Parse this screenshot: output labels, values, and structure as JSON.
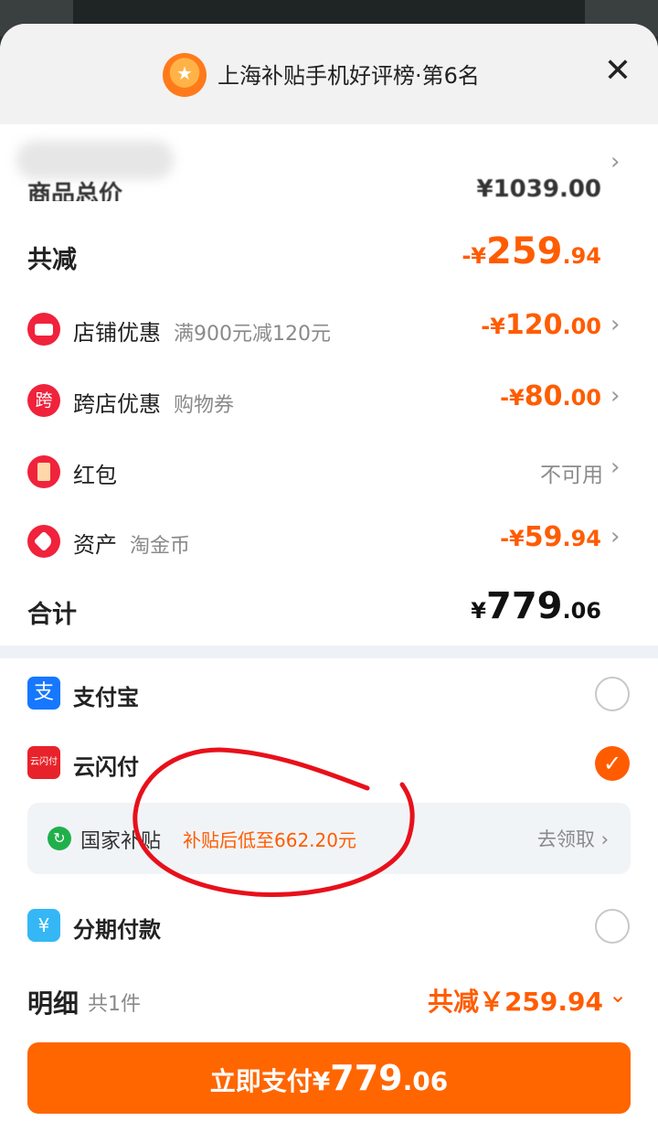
{
  "header": {
    "title": "上海补贴手机好评榜·第6名",
    "close": "✕"
  },
  "summary": {
    "obscured_label": "商品总价",
    "obscured_amount": "¥1039.00",
    "total_discount": {
      "label": "共减",
      "prefix": "-¥",
      "int": "259",
      "dec": ".94"
    },
    "rows": [
      {
        "label": "店铺优惠",
        "sub": "满900元减120元",
        "prefix": "-¥",
        "int": "120",
        "dec": ".00",
        "icon": "store-icon"
      },
      {
        "label": "跨店优惠",
        "sub": "购物券",
        "prefix": "-¥",
        "int": "80",
        "dec": ".00",
        "icon_text": "跨"
      },
      {
        "label": "红包",
        "sub": "",
        "status": "不可用",
        "icon": "red-envelope-icon"
      },
      {
        "label": "资产",
        "sub": "淘金币",
        "prefix": "-¥",
        "int": "59",
        "dec": ".94",
        "icon": "tag-icon"
      }
    ],
    "total": {
      "label": "合计",
      "prefix": "¥",
      "int": "779",
      "dec": ".06"
    }
  },
  "payment": {
    "methods": [
      {
        "label": "支付宝",
        "icon": "alipay-icon",
        "icon_text": "支",
        "selected": false
      },
      {
        "label": "云闪付",
        "icon": "unionpay-quickpass-icon",
        "icon_text": "云闪付",
        "selected": true
      },
      {
        "label": "分期付款",
        "icon": "installment-icon",
        "icon_text": "¥",
        "selected": false
      }
    ],
    "subsidy": {
      "label": "国家补贴",
      "desc": "补贴后低至662.20元",
      "action": "去领取"
    }
  },
  "detail": {
    "title": "明细",
    "count": "共1件",
    "saving": "共减￥259.94"
  },
  "pay_button": {
    "label": "立即支付",
    "prefix": "¥",
    "int": "779",
    "dec": ".06"
  },
  "colors": {
    "accent": "#ff5c00",
    "button": "#ff6600",
    "annotation": "#e8101a"
  }
}
